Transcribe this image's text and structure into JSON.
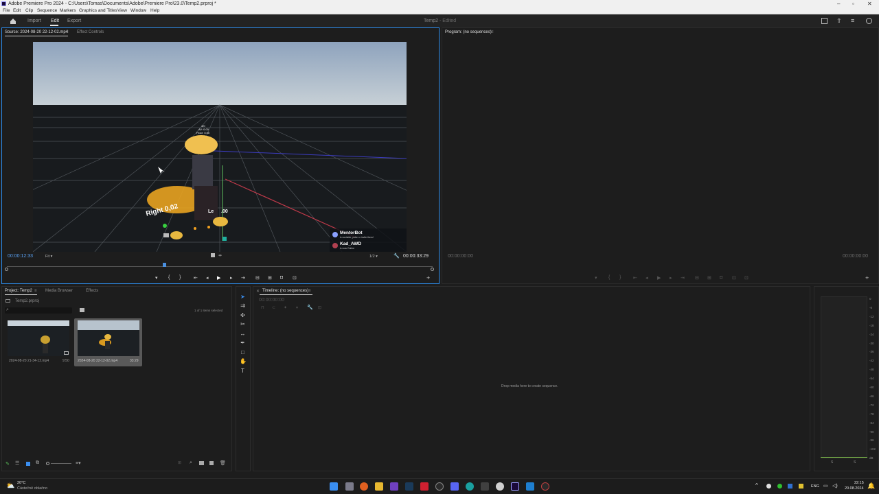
{
  "window": {
    "title": "Adobe Premiere Pro 2024 - C:\\Users\\Tomas\\Documents\\Adobe\\Premiere Pro\\23.0\\Temp2.prproj *"
  },
  "menu": [
    "File",
    "Edit",
    "Clip",
    "Sequence",
    "Markers",
    "Graphics and Titles",
    "View",
    "Window",
    "Help"
  ],
  "header": {
    "import": "Import",
    "edit": "Edit",
    "export": "Export",
    "project_name": "Temp2",
    "status": " - Edited"
  },
  "source": {
    "tab_source": "Source: 2024-08-20 22-12-02.mp4",
    "tab_effects": "Effect Controls",
    "timecode_current": "00:00:12:33",
    "timecode_duration": "00:00:33:29",
    "zoom": "Fit",
    "resolution": "1/2",
    "playhead_fraction": 0.37,
    "overlay": {
      "right_label": "Right 0,02",
      "left_label": "Le",
      "left_value": ".00",
      "stats": [
        "4/0",
        "AV: 0.00",
        "Floor: 0.00"
      ],
      "user1_name": "MentorBot",
      "user1_sub": "is sociable, poke or invite them!",
      "user2_name": "Kad_AWD",
      "user2_sub": "is now Online"
    }
  },
  "program": {
    "tab": "Program: (no sequences)",
    "tc_left": "00:00:00:00",
    "tc_right": "00:00:00:00"
  },
  "project": {
    "tab_project": "Project: Temp2",
    "tab_media": "Media Browser",
    "tab_effects": "Effects",
    "file": "Temp2.prproj",
    "selection": "1 of 1 items selected",
    "items": [
      {
        "name": "2024-08-20 21-34-12.mp4",
        "duration": "9:50"
      },
      {
        "name": "2024-08-20 22-12-02.mp4",
        "duration": "33:29"
      }
    ]
  },
  "timeline": {
    "tab": "Timeline: (no sequences)",
    "timecode": "00:00:00:00",
    "drop_hint": "Drop media here to create sequence."
  },
  "meter": {
    "labels": [
      "0",
      "-6",
      "-12",
      "-18",
      "-24",
      "-30",
      "-36",
      "-42",
      "-48",
      "-54",
      "-60",
      "-66",
      "-72",
      "-78",
      "-84",
      "-90",
      "-96",
      "-102",
      "dB"
    ],
    "bottom": [
      "S",
      "S"
    ]
  },
  "taskbar": {
    "weather_temp": "20°C",
    "weather_text": "Částečně oblačno",
    "lang": "ENG",
    "time": "22:15",
    "date": "20.08.2024"
  },
  "colors": {
    "accent": "#2d8ceb",
    "timecode": "#5aa0f0",
    "panel": "#1d1d1d"
  }
}
